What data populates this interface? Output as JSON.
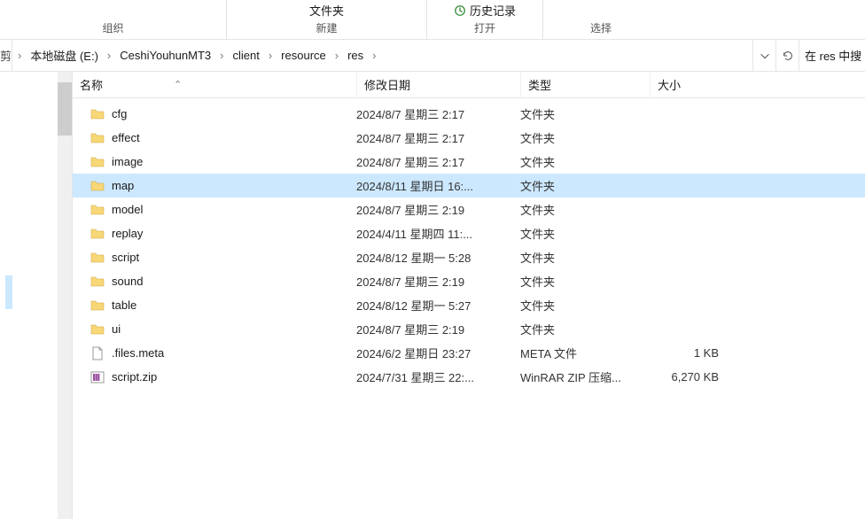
{
  "ribbon": {
    "groups": [
      {
        "label": "组织",
        "items": []
      },
      {
        "label": "新建",
        "items": [
          "文件夹"
        ]
      },
      {
        "label": "打开",
        "items": [
          "历史记录"
        ]
      },
      {
        "label": "选择",
        "items": []
      }
    ]
  },
  "address": {
    "fragment": "剪",
    "segments": [
      "本地磁盘 (E:)",
      "CeshiYouhunMT3",
      "client",
      "resource",
      "res"
    ],
    "search_placeholder": "在 res 中搜"
  },
  "columns": {
    "name": "名称",
    "sort_indicator": "⌃",
    "date": "修改日期",
    "type": "类型",
    "size": "大小"
  },
  "type_labels": {
    "folder": "文件夹",
    "meta": "META 文件",
    "zip": "WinRAR ZIP 压缩..."
  },
  "items": [
    {
      "name": "cfg",
      "date": "2024/8/7 星期三 2:17",
      "type": "folder",
      "size": "",
      "sel": false,
      "icon": "folder"
    },
    {
      "name": "effect",
      "date": "2024/8/7 星期三 2:17",
      "type": "folder",
      "size": "",
      "sel": false,
      "icon": "folder"
    },
    {
      "name": "image",
      "date": "2024/8/7 星期三 2:17",
      "type": "folder",
      "size": "",
      "sel": false,
      "icon": "folder"
    },
    {
      "name": "map",
      "date": "2024/8/11 星期日 16:...",
      "type": "folder",
      "size": "",
      "sel": true,
      "icon": "folder"
    },
    {
      "name": "model",
      "date": "2024/8/7 星期三 2:19",
      "type": "folder",
      "size": "",
      "sel": false,
      "icon": "folder"
    },
    {
      "name": "replay",
      "date": "2024/4/11 星期四 11:...",
      "type": "folder",
      "size": "",
      "sel": false,
      "icon": "folder"
    },
    {
      "name": "script",
      "date": "2024/8/12 星期一 5:28",
      "type": "folder",
      "size": "",
      "sel": false,
      "icon": "folder"
    },
    {
      "name": "sound",
      "date": "2024/8/7 星期三 2:19",
      "type": "folder",
      "size": "",
      "sel": false,
      "icon": "folder"
    },
    {
      "name": "table",
      "date": "2024/8/12 星期一 5:27",
      "type": "folder",
      "size": "",
      "sel": false,
      "icon": "folder"
    },
    {
      "name": "ui",
      "date": "2024/8/7 星期三 2:19",
      "type": "folder",
      "size": "",
      "sel": false,
      "icon": "folder"
    },
    {
      "name": ".files.meta",
      "date": "2024/6/2 星期日 23:27",
      "type": "meta",
      "size": "1 KB",
      "sel": false,
      "icon": "file"
    },
    {
      "name": "script.zip",
      "date": "2024/7/31 星期三 22:...",
      "type": "zip",
      "size": "6,270 KB",
      "sel": false,
      "icon": "zip"
    }
  ]
}
